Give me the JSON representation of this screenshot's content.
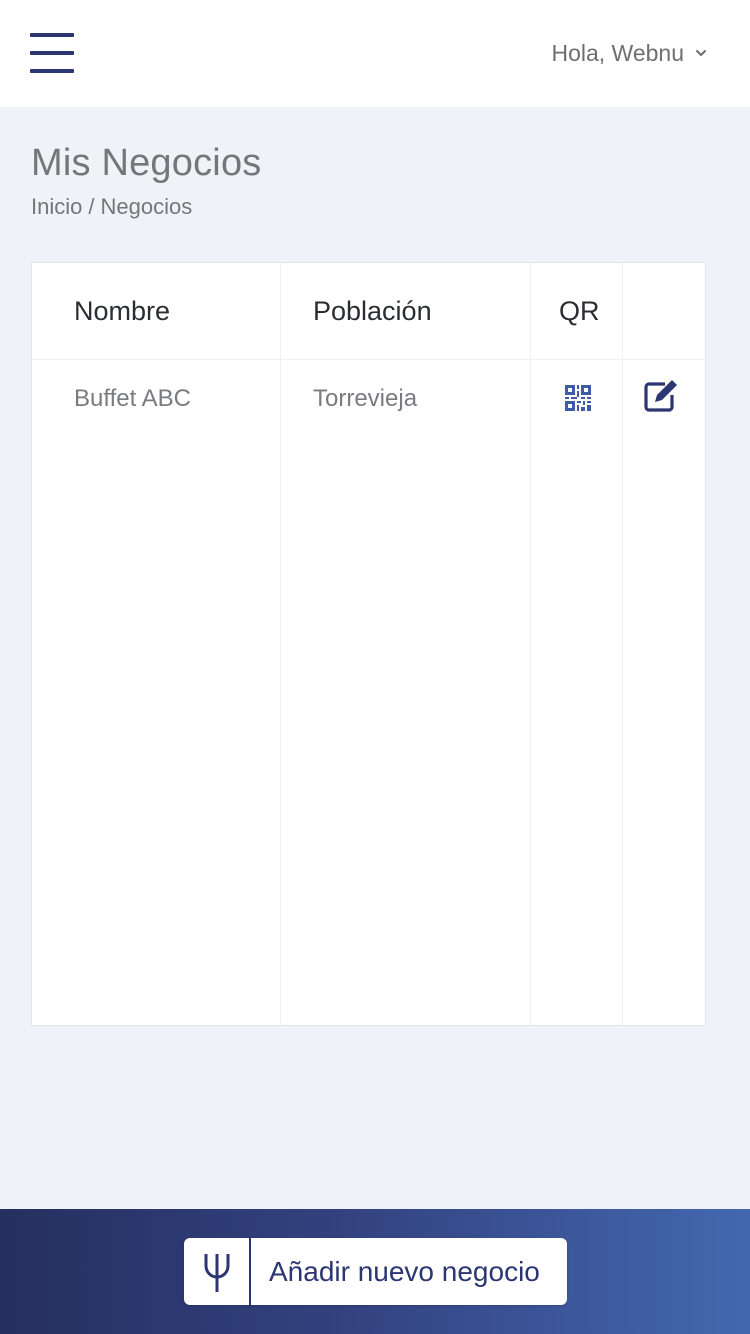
{
  "header": {
    "greeting": "Hola, Webnu"
  },
  "page": {
    "title": "Mis Negocios",
    "breadcrumb": {
      "home": "Inicio",
      "separator": "/",
      "current": "Negocios"
    }
  },
  "table": {
    "columns": [
      "Nombre",
      "Población",
      "QR",
      ""
    ],
    "rows": [
      {
        "nombre": "Buffet ABC",
        "poblacion": "Torrevieja",
        "qr_icon": "qr-code-icon",
        "action_icon": "edit-icon"
      }
    ]
  },
  "footer": {
    "add_button_label": "Añadir nuevo negocio",
    "logo_icon": "fork-logo-icon"
  },
  "colors": {
    "brand_dark": "#2c3672",
    "gradient_start": "#25305f",
    "gradient_end": "#4368b0",
    "background": "#f1f2f7"
  }
}
